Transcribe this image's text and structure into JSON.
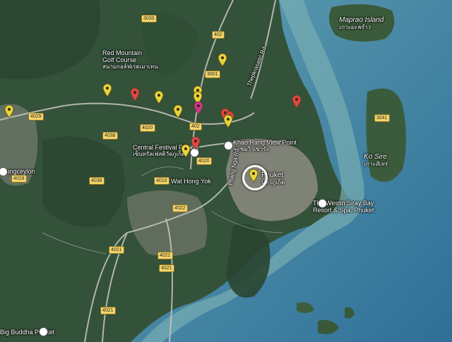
{
  "places": {
    "maprao": "Maprao Island",
    "maprao_th": "เกาะมะพร้าว",
    "red_mountain": "Red Mountain",
    "red_mountain_2": "Golf Course",
    "red_mountain_th": "สนามกอล์ฟเรดเมาเทน",
    "central_festival": "Central Festival Phuket",
    "central_festival_th": "เซ็นทรัลเฟสติวัลภูเก็ต",
    "khao_rang": "Khao Rang View Point",
    "khao_rang_th": "จุดชมวิวเขารัง",
    "phuket": "Phuket",
    "phuket_th": "นครภูเก็ต",
    "ko_sire": "Ko Sire",
    "ko_sire_th": "เกาะสิเหร่",
    "westin": "The Westin Siray Bay",
    "westin_2": "Resort & Spa, Phuket",
    "jungceylon": "Jungceylon",
    "wat_hong_yok": "Wat Hong Yok",
    "big_buddha": "Big Buddha Phuket",
    "thepkrasattri": "Thepkrasattri Rd",
    "phangnga": "Phang Nga Rd"
  },
  "road_shields": [
    "3030",
    "402",
    "3001",
    "4029",
    "4038",
    "4020",
    "402",
    "4020",
    "4038",
    "4010",
    "4022",
    "4021",
    "4021",
    "4021",
    "4021",
    "3041",
    "4028"
  ],
  "markers": {
    "yellow": "#e7d43a",
    "red": "#e04646",
    "magenta": "#d0338f",
    "items": [
      {
        "color": "yellow"
      },
      {
        "color": "yellow"
      },
      {
        "color": "red"
      },
      {
        "color": "yellow"
      },
      {
        "color": "yellow"
      },
      {
        "color": "yellow"
      },
      {
        "color": "yellow"
      },
      {
        "color": "magenta"
      },
      {
        "color": "red"
      },
      {
        "color": "yellow"
      },
      {
        "color": "yellow"
      },
      {
        "color": "red"
      },
      {
        "color": "red"
      },
      {
        "color": "yellow"
      },
      {
        "color": "red"
      },
      {
        "color": "yellow"
      }
    ]
  },
  "colors": {
    "forest": "#35533a",
    "sea": "#4f8ea8",
    "shallow": "#7fb3b6",
    "urban": "#8f8d84"
  }
}
